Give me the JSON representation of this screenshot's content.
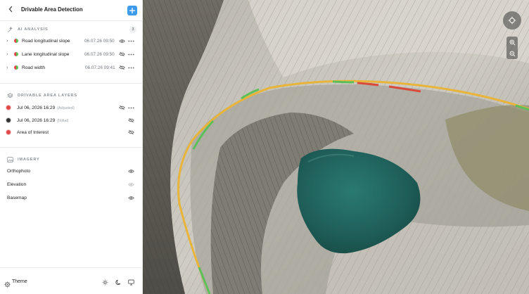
{
  "header": {
    "title": "Drivable Area Detection",
    "back_icon": "chevron-left-icon",
    "add_icon": "plus-icon"
  },
  "ai_analysis": {
    "title": "AI ANALYSIS",
    "count": "3",
    "items": [
      {
        "label": "Road longitudinal slope",
        "timestamp": "06.07.26 09:50",
        "visibility": "visible"
      },
      {
        "label": "Lane longitudinal slope",
        "timestamp": "06.07.26 09:50",
        "visibility": "hidden"
      },
      {
        "label": "Road width",
        "timestamp": "06.07.26 09:41",
        "visibility": "hidden"
      }
    ]
  },
  "drivable_layers": {
    "title": "DRIVABLE AREA LAYERS",
    "items": [
      {
        "label": "Jul 06, 2026 16:29",
        "sub": "(Adjusted)",
        "dot_color": "#e04848",
        "visibility": "hidden"
      },
      {
        "label": "Jul 06, 2026 16:29",
        "sub": "(Initial)",
        "dot_color": "#333333",
        "visibility": "hidden"
      },
      {
        "label": "Area of Interest",
        "sub": "",
        "dot_color": "#e04848",
        "visibility": "hidden"
      }
    ]
  },
  "imagery": {
    "title": "IMAGERY",
    "items": [
      {
        "label": "Orthophoto",
        "visibility": "visible"
      },
      {
        "label": "Elevation",
        "visibility": "faded"
      },
      {
        "label": "Basemap",
        "visibility": "visible"
      }
    ]
  },
  "footer": {
    "theme_label": "Theme",
    "modes": [
      "sun-icon",
      "moon-icon",
      "monitor-icon"
    ]
  },
  "map_controls": [
    "compass-icon",
    "zoom-in-icon",
    "zoom-out-icon"
  ],
  "colors": {
    "accent": "#3d9be9",
    "road_yellow": "#e8b43a",
    "road_green": "#5cc05a",
    "road_red": "#d84b3b",
    "water": "#1f5f5a"
  }
}
